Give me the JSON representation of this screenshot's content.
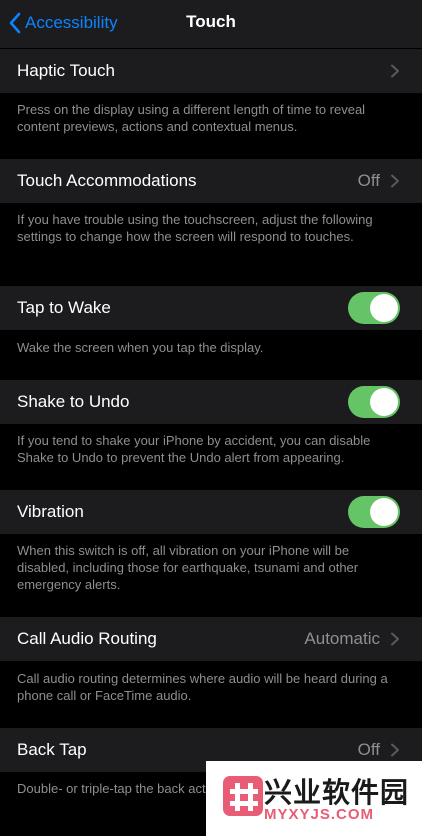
{
  "nav": {
    "back_label": "Accessibility",
    "title": "Touch"
  },
  "rows": [
    {
      "label": "Haptic Touch",
      "value": "",
      "control": "chevron",
      "footer": "Press on the display using a different length of time to reveal content previews, actions and contextual menus."
    },
    {
      "label": "Touch Accommodations",
      "value": "Off",
      "control": "chevron",
      "footer": "If you have trouble using the touchscreen, adjust the following settings to change how the screen will respond to touches."
    },
    {
      "label": "Tap to Wake",
      "control": "toggle",
      "on": true,
      "footer": "Wake the screen when you tap the display."
    },
    {
      "label": "Shake to Undo",
      "control": "toggle",
      "on": true,
      "footer": "If you tend to shake your iPhone by accident, you can disable Shake to Undo to prevent the Undo alert from appearing."
    },
    {
      "label": "Vibration",
      "control": "toggle",
      "on": true,
      "footer": "When this switch is off, all vibration on your iPhone will be disabled, including those for earthquake, tsunami and other emergency alerts."
    },
    {
      "label": "Call Audio Routing",
      "value": "Automatic",
      "control": "chevron",
      "footer": "Call audio routing determines where audio will be heard during a phone call or FaceTime audio."
    },
    {
      "label": "Back Tap",
      "value": "Off",
      "control": "chevron",
      "footer": "Double- or triple-tap the back actions quickly."
    }
  ],
  "watermark": {
    "cn_text": "兴业软件园",
    "en_text": "MYXYJS.COM"
  },
  "colors": {
    "accent": "#0a84ff",
    "toggle_on": "#65c466",
    "cell_bg": "#1c1c1e",
    "secondary_text": "#8e8e93"
  }
}
